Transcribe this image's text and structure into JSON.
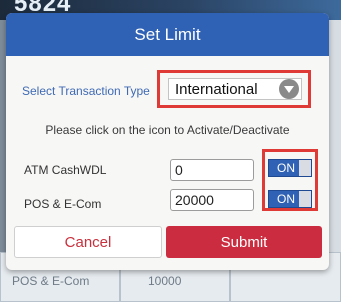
{
  "background": {
    "top_text": "5824",
    "table_rows": [
      "POS & E-Com",
      "10000"
    ]
  },
  "dialog": {
    "title": "Set Limit",
    "transaction_type_label": "Select Transaction Type",
    "transaction_type_value": "International",
    "instruction": "Please click on the icon to Activate/Deactivate",
    "rows": [
      {
        "label": "ATM CashWDL",
        "value": "0",
        "toggle": "ON"
      },
      {
        "label": "POS & E-Com",
        "value": "20000",
        "toggle": "ON"
      }
    ],
    "cancel_label": "Cancel",
    "submit_label": "Submit"
  },
  "colors": {
    "header": "#2f61b4",
    "highlight": "#e03a36",
    "submit": "#cb2c3f",
    "toggle_on": "#2f61b4"
  },
  "icons": [
    "dropdown-caret-icon"
  ]
}
